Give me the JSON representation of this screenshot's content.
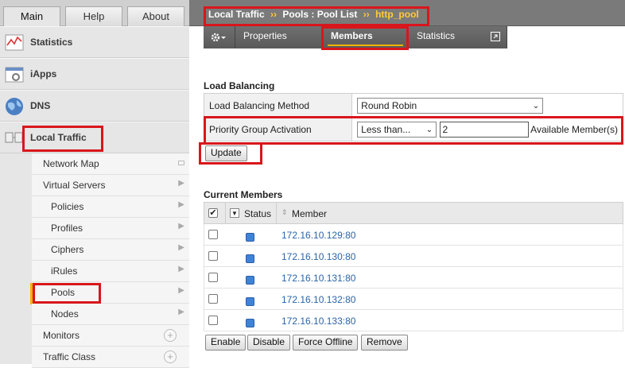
{
  "nav": {
    "tabs": [
      "Main",
      "Help",
      "About"
    ],
    "sections": [
      {
        "label": "Statistics",
        "icon": "statistics-chart-icon"
      },
      {
        "label": "iApps",
        "icon": "iapps-gear-icon"
      },
      {
        "label": "DNS",
        "icon": "dns-globe-icon"
      },
      {
        "label": "Local Traffic",
        "icon": "local-traffic-icon"
      }
    ],
    "items": [
      {
        "label": "Network Map"
      },
      {
        "label": "Virtual Servers"
      },
      {
        "label": "Policies"
      },
      {
        "label": "Profiles"
      },
      {
        "label": "Ciphers"
      },
      {
        "label": "iRules"
      },
      {
        "label": "Pools"
      },
      {
        "label": "Nodes"
      },
      {
        "label": "Monitors"
      },
      {
        "label": "Traffic Class"
      }
    ]
  },
  "breadcrumb": {
    "part1": "Local Traffic",
    "sep": "››",
    "part2": "Pools : Pool List",
    "current": "http_pool"
  },
  "subtabs": [
    "Properties",
    "Members",
    "Statistics"
  ],
  "load_balancing": {
    "title": "Load Balancing",
    "method_label": "Load Balancing Method",
    "method_value": "Round Robin",
    "pga_label": "Priority Group Activation",
    "pga_select": "Less than...",
    "pga_value": "2",
    "pga_suffix": "Available Member(s)",
    "update_button": "Update"
  },
  "current_members": {
    "title": "Current Members",
    "col_status": "Status",
    "col_member": "Member",
    "rows": [
      {
        "member": "172.16.10.129:80"
      },
      {
        "member": "172.16.10.130:80"
      },
      {
        "member": "172.16.10.131:80"
      },
      {
        "member": "172.16.10.132:80"
      },
      {
        "member": "172.16.10.133:80"
      }
    ],
    "buttons": [
      "Enable",
      "Disable",
      "Force Offline",
      "Remove"
    ]
  },
  "colors": {
    "highlight": "#d9161c",
    "accent": "#f0b400",
    "status_available": "#3f83d6"
  }
}
